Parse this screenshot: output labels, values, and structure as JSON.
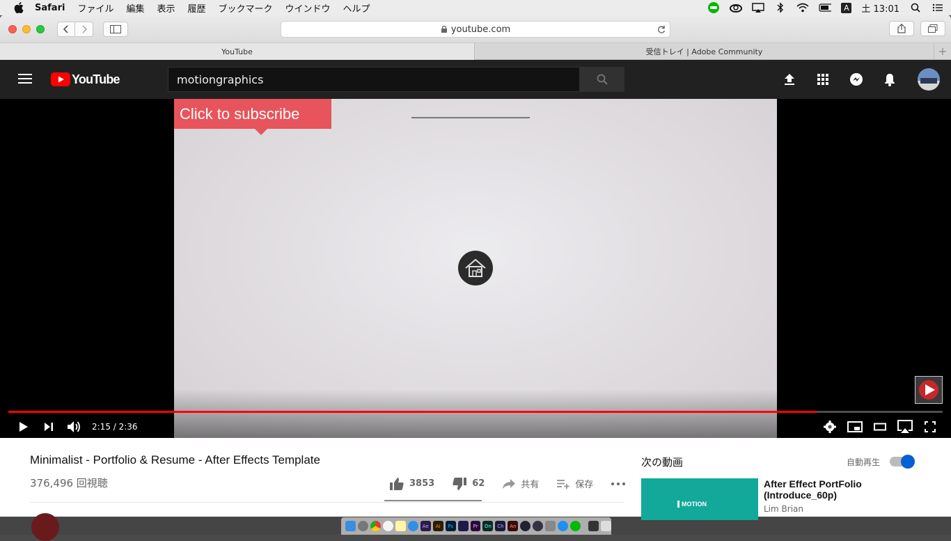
{
  "menubar": {
    "app_name": "Safari",
    "items": [
      "ファイル",
      "編集",
      "表示",
      "履歴",
      "ブックマーク",
      "ウインドウ",
      "ヘルプ"
    ],
    "clock": "土 13:01",
    "input_indicator": "A"
  },
  "browser": {
    "url": "youtube.com",
    "tabs": [
      {
        "label": "YouTube",
        "active": true
      },
      {
        "label": "受信トレイ | Adobe Community",
        "active": false
      }
    ]
  },
  "youtube": {
    "logo_text": "YouTube",
    "search_value": "motiongraphics",
    "player": {
      "subscribe_text": "Click to subscribe",
      "time_text": "2:15 / 2:36",
      "progress_fraction": 0.8654
    },
    "video": {
      "title": "Minimalist - Portfolio & Resume - After Effects Template",
      "views": "376,496 回視聴",
      "likes": "3853",
      "dislikes": "62",
      "share_label": "共有",
      "save_label": "保存"
    },
    "sidebar": {
      "up_next_label": "次の動画",
      "autoplay_label": "自動再生",
      "autoplay_on": true,
      "next_video": {
        "thumb_text": "MOTION",
        "title": "After Effect PortFolio (Introduce_60p)",
        "channel": "Lim Brian"
      }
    }
  },
  "colors": {
    "youtube_red": "#ff0000",
    "subscribe_bg": "#e8545b",
    "header_bg": "#212121",
    "toggle_blue": "#065fd4"
  }
}
